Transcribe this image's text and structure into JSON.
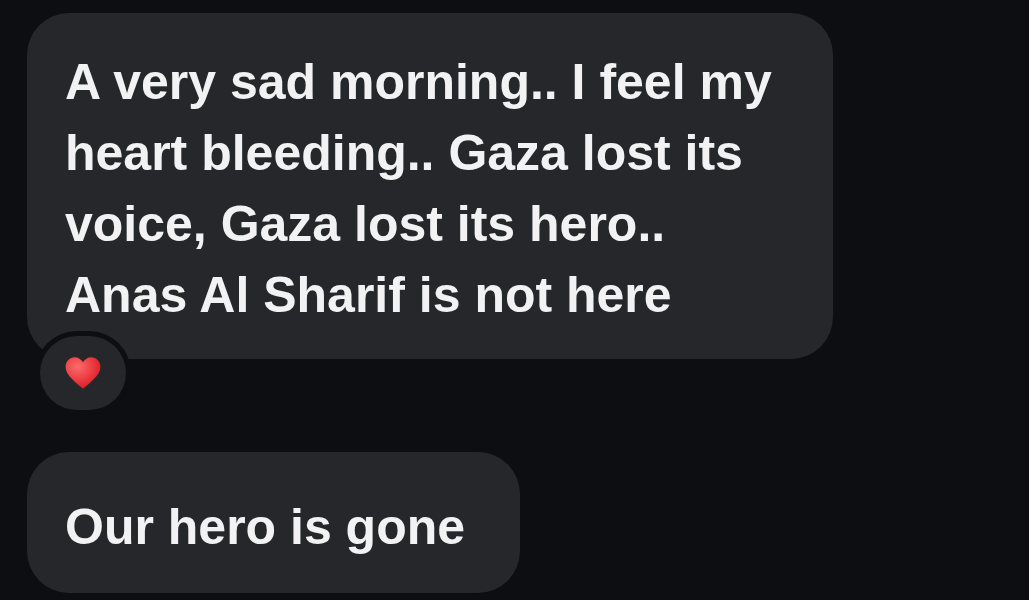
{
  "messages": [
    {
      "text": "A very sad morning.. I feel my heart bleeding.. Gaza lost its voice, Gaza lost its hero.. Anas Al Sharif is not here",
      "reaction": {
        "kind": "heart"
      }
    },
    {
      "text": "Our hero is gone"
    }
  ]
}
